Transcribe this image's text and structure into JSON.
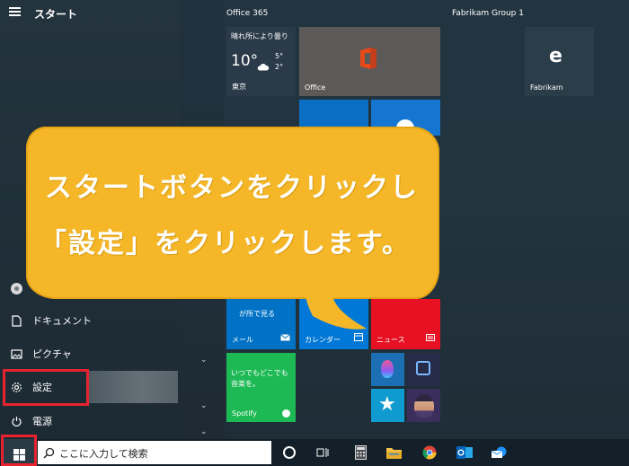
{
  "start_menu": {
    "title": "スタート",
    "rail": {
      "items": [
        {
          "label": "",
          "icon": "user-avatar-icon"
        },
        {
          "label": "ドキュメント",
          "icon": "document-icon"
        },
        {
          "label": "ピクチャ",
          "icon": "pictures-icon"
        },
        {
          "label": "設定",
          "icon": "gear-icon"
        },
        {
          "label": "電源",
          "icon": "power-icon"
        }
      ]
    },
    "groups": [
      {
        "title": "Office 365"
      },
      {
        "title": "Fabrikam Group 1"
      }
    ],
    "tiles": {
      "weather": {
        "caption": "晴れ所により曇り",
        "temp_main": "10°",
        "temp_high": "5°",
        "temp_low": "2°",
        "city": "東京"
      },
      "office": {
        "label": "Office"
      },
      "fabrikam": {
        "label": "Fabrikam"
      },
      "mail": {
        "label": "メール",
        "snippet": "が所で見る"
      },
      "calendar": {
        "label": "カレンダー"
      },
      "news": {
        "label": "ニュース"
      },
      "spotify": {
        "text_line1": "いつでもどこでも",
        "text_line2": "音楽を。",
        "label": "Spotify"
      }
    }
  },
  "callout": {
    "line1": "スタートボタンをクリックし",
    "line2": "「設定」をクリックします。"
  },
  "taskbar": {
    "search_placeholder": "ここに入力して検索",
    "icons": [
      "cortana-icon",
      "task-view-icon",
      "calculator-icon",
      "file-explorer-icon",
      "chrome-icon",
      "outlook-icon",
      "mail-app-icon"
    ]
  },
  "colors": {
    "accent_red": "#e8232f",
    "callout_yellow": "#f5b728",
    "tile_blue": "#0078d7",
    "tile_green": "#1db954",
    "tile_red": "#e81123"
  }
}
